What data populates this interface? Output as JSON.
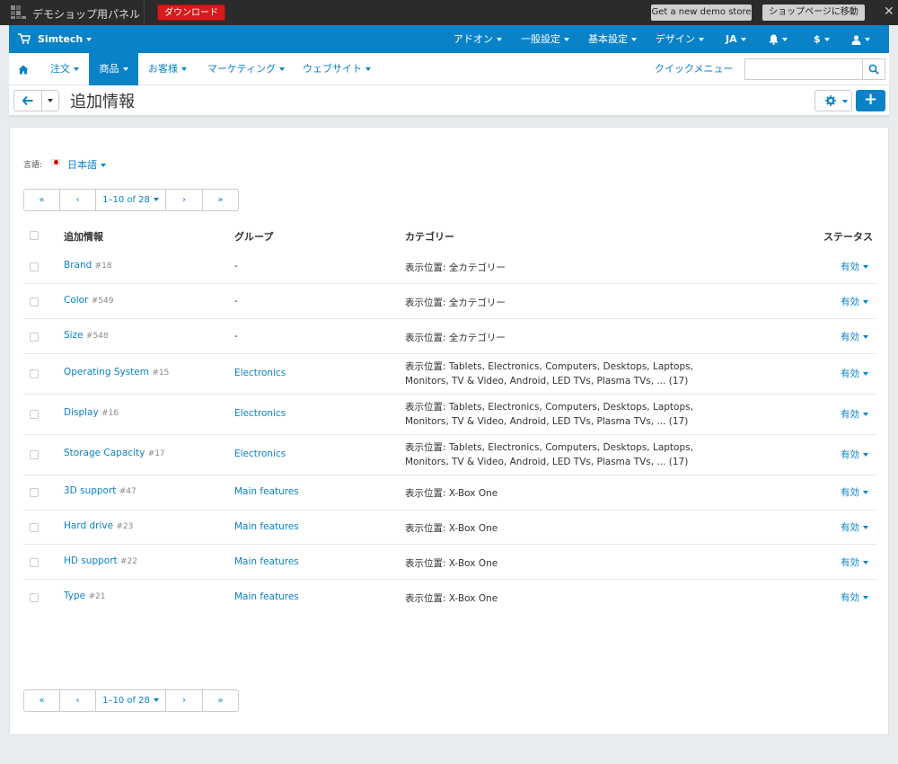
{
  "demo_bar": {
    "title": "デモショップ用パネル",
    "download": "ダウンロード",
    "new_demo": "Get a new demo store",
    "go_shop": "ショップページに移動",
    "close": "✕"
  },
  "admin_bar": {
    "store": "Simtech",
    "addons": "アドオン",
    "general": "一般設定",
    "basic": "基本設定",
    "design": "デザイン",
    "language": "JA",
    "currency": "$"
  },
  "nav": {
    "orders": "注文",
    "products": "商品",
    "customers": "お客様",
    "marketing": "マーケティング",
    "website": "ウェブサイト",
    "quick_menu": "クイックメニュー",
    "search_placeholder": ""
  },
  "page": {
    "title": "追加情報",
    "lang_label": "言語:",
    "lang_value": "日本語"
  },
  "pager": {
    "first": "«",
    "prev": "‹",
    "range": "1–10 of 28",
    "next": "›",
    "last": "»"
  },
  "table": {
    "headers": {
      "name": "追加情報",
      "group": "グループ",
      "category": "カテゴリー",
      "status": "ステータス"
    },
    "rows": [
      {
        "name": "Brand",
        "id": "#18",
        "group": "-",
        "category": "表示位置: 全カテゴリー",
        "status": "有効"
      },
      {
        "name": "Color",
        "id": "#549",
        "group": "-",
        "category": "表示位置: 全カテゴリー",
        "status": "有効"
      },
      {
        "name": "Size",
        "id": "#548",
        "group": "-",
        "category": "表示位置: 全カテゴリー",
        "status": "有効"
      },
      {
        "name": "Operating System",
        "id": "#15",
        "group": "Electronics",
        "category": "表示位置: Tablets, Electronics, Computers, Desktops, Laptops, Monitors, TV & Video, Android, LED TVs, Plasma TVs, ... (17)",
        "status": "有効"
      },
      {
        "name": "Display",
        "id": "#16",
        "group": "Electronics",
        "category": "表示位置: Tablets, Electronics, Computers, Desktops, Laptops, Monitors, TV & Video, Android, LED TVs, Plasma TVs, ... (17)",
        "status": "有効"
      },
      {
        "name": "Storage Capacity",
        "id": "#17",
        "group": "Electronics",
        "category": "表示位置: Tablets, Electronics, Computers, Desktops, Laptops, Monitors, TV & Video, Android, LED TVs, Plasma TVs, ... (17)",
        "status": "有効"
      },
      {
        "name": "3D support",
        "id": "#47",
        "group": "Main features",
        "category": "表示位置: X-Box One",
        "status": "有効"
      },
      {
        "name": "Hard drive",
        "id": "#23",
        "group": "Main features",
        "category": "表示位置: X-Box One",
        "status": "有効"
      },
      {
        "name": "HD support",
        "id": "#22",
        "group": "Main features",
        "category": "表示位置: X-Box One",
        "status": "有効"
      },
      {
        "name": "Type",
        "id": "#21",
        "group": "Main features",
        "category": "表示位置: X-Box One",
        "status": "有効"
      }
    ]
  },
  "colors": {
    "accent": "#0a82c8",
    "danger": "#d71a1a",
    "topbar": "#2b2b2b"
  }
}
